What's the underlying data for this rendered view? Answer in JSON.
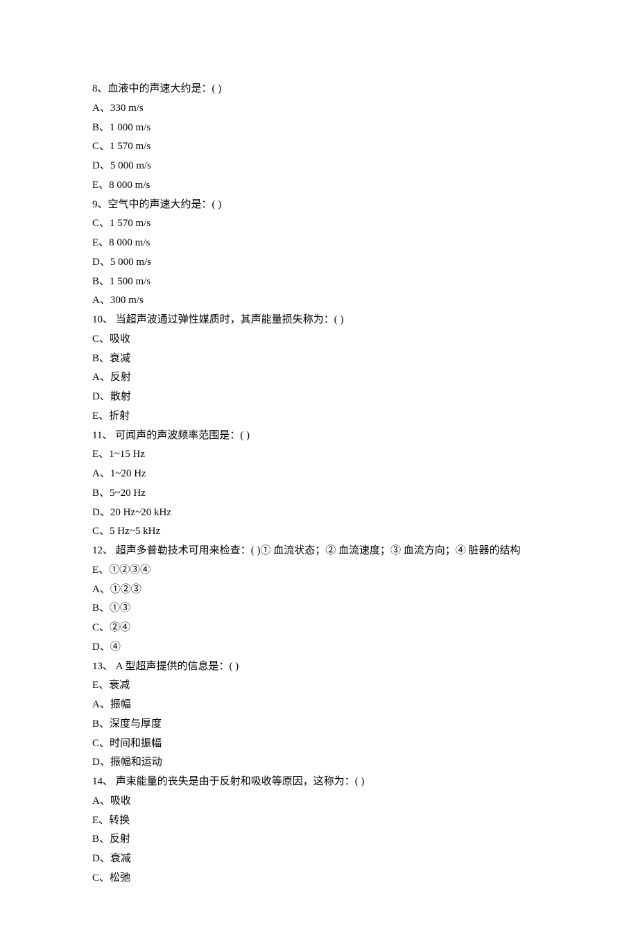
{
  "questions": [
    {
      "q": "8、血液中的声速大约是：( )",
      "opts": [
        "A、330 m/s",
        "B、1 000 m/s",
        "C、1 570 m/s",
        "D、5 000 m/s",
        "E、8 000 m/s"
      ]
    },
    {
      "q": "9、空气中的声速大约是：( )",
      "opts": [
        "C、1 570 m/s",
        "E、8 000 m/s",
        "D、5 000 m/s",
        "B、1 500 m/s",
        "A、300 m/s"
      ]
    },
    {
      "q": "10、 当超声波通过弹性媒质时，其声能量损失称为：( )",
      "opts": [
        "C、吸收",
        "B、衰减",
        "A、反射",
        "D、散射",
        "E、折射"
      ]
    },
    {
      "q": "11、 可闻声的声波频率范围是：( )",
      "opts": [
        "E、1~15 Hz",
        "A、1~20 Hz",
        "B、5~20 Hz",
        "D、20 Hz~20 kHz",
        "C、5 Hz~5 kHz"
      ]
    },
    {
      "q": "12、 超声多普勒技术可用来检查：( )①  血流状态；②  血流速度；③  血流方向；④  脏器的结构",
      "opts": [
        "E、①②③④",
        "A、①②③",
        "B、①③",
        "C、②④",
        "D、④"
      ]
    },
    {
      "q": "13、 A 型超声提供的信息是：( )",
      "opts": [
        "E、衰减",
        "A、振幅",
        "B、深度与厚度",
        "C、时间和振幅",
        "D、振幅和运动"
      ]
    },
    {
      "q": "14、 声束能量的丧失是由于反射和吸收等原因，这称为：( )",
      "opts": [
        "A、吸收",
        "E、转换",
        "B、反射",
        "D、衰减",
        "C、松弛"
      ]
    }
  ]
}
